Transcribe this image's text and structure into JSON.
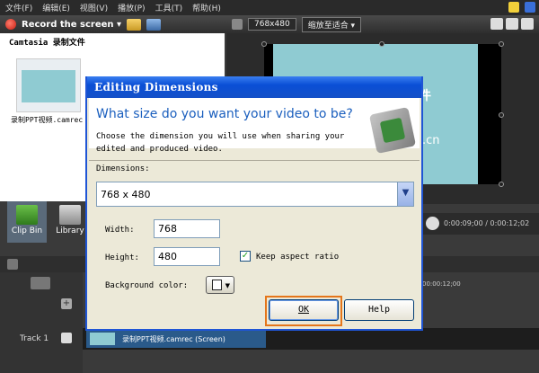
{
  "menu": {
    "items": [
      "文件(F)",
      "编辑(E)",
      "视图(V)",
      "播放(P)",
      "工具(T)",
      "帮助(H)"
    ]
  },
  "toolbar": {
    "record_label": "Record the screen ▾"
  },
  "preview_bar": {
    "dimensions": "768x480",
    "zoom": "缩放至适合 ▾"
  },
  "clip_bin": {
    "title": "Camtasia 录制文件",
    "file_name": "录制PPT视频.camrec"
  },
  "tabs": [
    {
      "label": "Clip Bin"
    },
    {
      "label": "Library"
    }
  ],
  "preview": {
    "overlay_text_1": "件",
    "overlay_text_2": ".cn"
  },
  "playback": {
    "time": "0:00:09;00 / 0:00:12;02"
  },
  "timeline": {
    "ruler_label": "00:00:12;00",
    "track_label": "Track 1",
    "clip_label": "录制PPT视频.camrec (Screen)"
  },
  "dialog": {
    "title": "Editing Dimensions",
    "question": "What size do you want your video to be?",
    "description": "Choose the dimension you will use when sharing your edited and produced video.",
    "dimensions_label": "Dimensions:",
    "dimensions_value": "768 x 480",
    "width_label": "Width:",
    "width_value": "768",
    "height_label": "Height:",
    "height_value": "480",
    "keep_aspect_label": "Keep aspect ratio",
    "keep_aspect_checked": true,
    "background_color_label": "Background color:",
    "ok_label": "OK",
    "help_label": "Help"
  }
}
